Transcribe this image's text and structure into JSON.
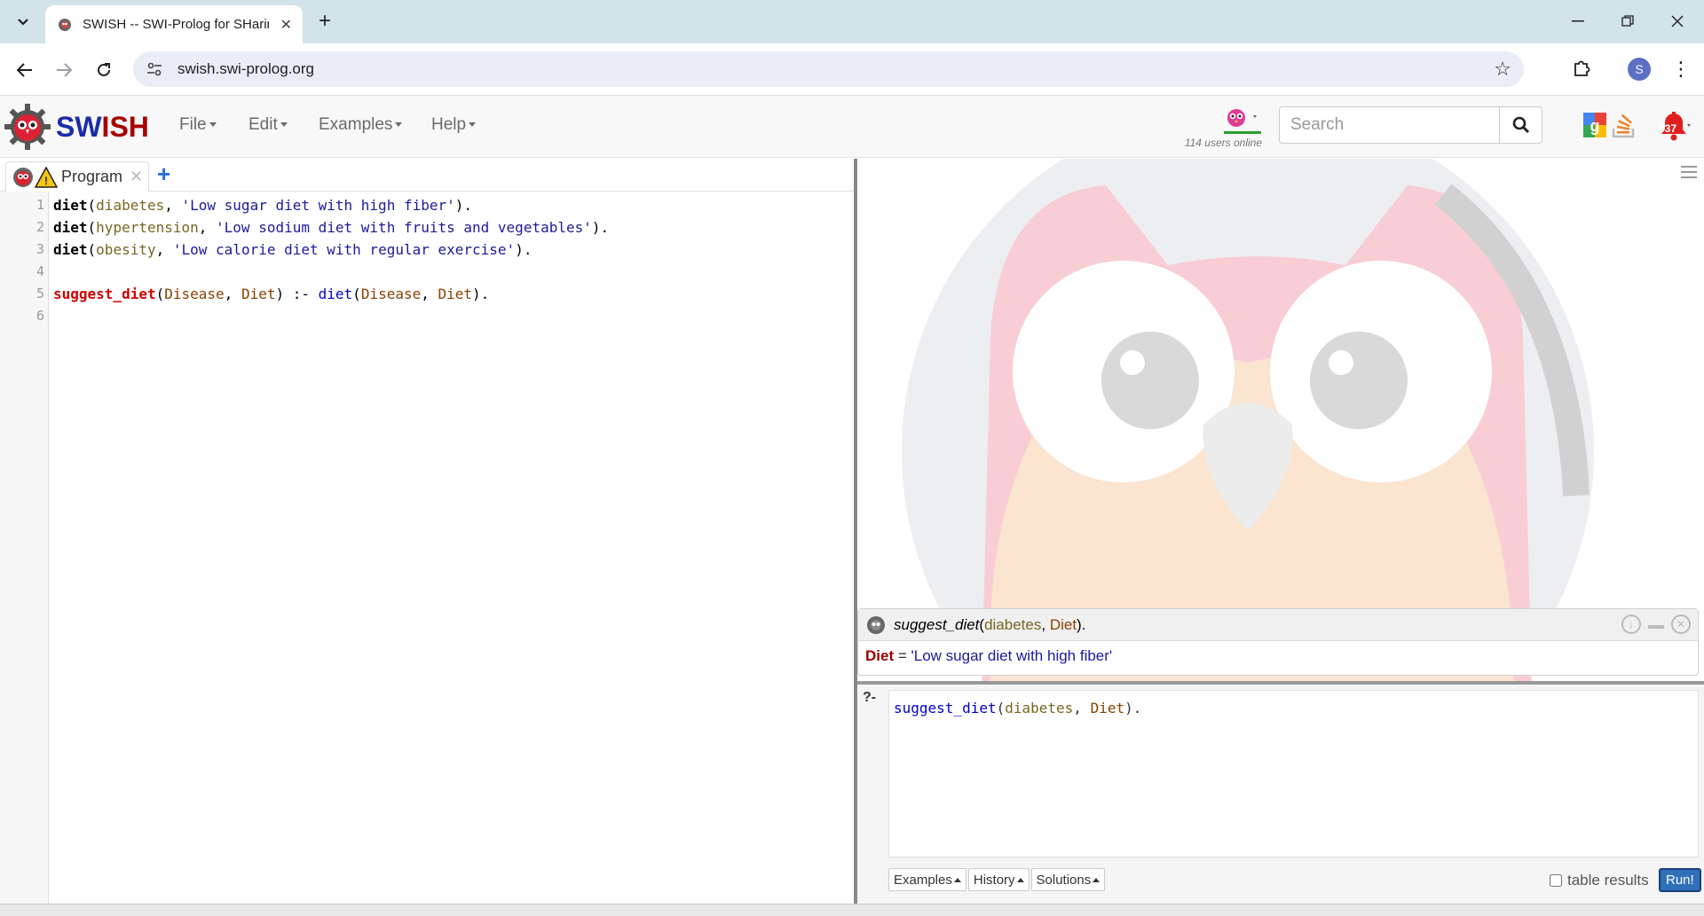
{
  "browser": {
    "tab_title": "SWISH -- SWI-Prolog for SHaring",
    "url": "swish.swi-prolog.org",
    "profile_initial": "S",
    "icons": [
      "tab-search-icon",
      "close-icon",
      "plus-icon",
      "minimize-icon",
      "restore-icon",
      "back-arrow-icon",
      "forward-arrow-icon",
      "reload-icon",
      "site-info-icon",
      "star-icon",
      "extensions-icon",
      "kebab-menu-icon"
    ]
  },
  "navbar": {
    "brand_sw": "SW",
    "brand_ish": "ISH",
    "menus": [
      "File",
      "Edit",
      "Examples",
      "Help"
    ],
    "users_online": "114 users online",
    "search_placeholder": "Search",
    "notification_count": "037"
  },
  "editor": {
    "tab_label": "Program",
    "line_numbers": [
      "1",
      "2",
      "3",
      "4",
      "5",
      "6"
    ],
    "lines": [
      {
        "pred": "diet",
        "open": "(",
        "atom": "diabetes",
        "sep": ", ",
        "str": "'Low sugar diet with high fiber'",
        "close": ")."
      },
      {
        "pred": "diet",
        "open": "(",
        "atom": "hypertension",
        "sep": ", ",
        "str": "'Low sodium diet with fruits and vegetables'",
        "close": ")."
      },
      {
        "pred": "diet",
        "open": "(",
        "atom": "obesity",
        "sep": ", ",
        "str": "'Low calorie diet with regular exercise'",
        "close": ")."
      }
    ],
    "rule": {
      "head": "suggest_diet",
      "args": [
        "Disease",
        "Diet"
      ],
      "neck": " :- ",
      "body_pred": "diet",
      "body_args": [
        "Disease",
        "Diet"
      ]
    }
  },
  "answer": {
    "query_pred": "suggest_diet",
    "query_atom": "diabetes",
    "query_var": "Diet",
    "result_var": "Diet",
    "result_eq": " = ",
    "result_val": "'Low sugar diet with high fiber'"
  },
  "query": {
    "prompt": "?-",
    "pred": "suggest_diet",
    "atom": "diabetes",
    "var": "Diet",
    "buttons": [
      "Examples",
      "History",
      "Solutions"
    ],
    "table_results_label": "table results",
    "run_label": "Run!"
  },
  "colors": {
    "brand_blue": "#1a2da8",
    "brand_red": "#a80000",
    "run_button": "#3070b8",
    "rule_head": "#d00000"
  }
}
